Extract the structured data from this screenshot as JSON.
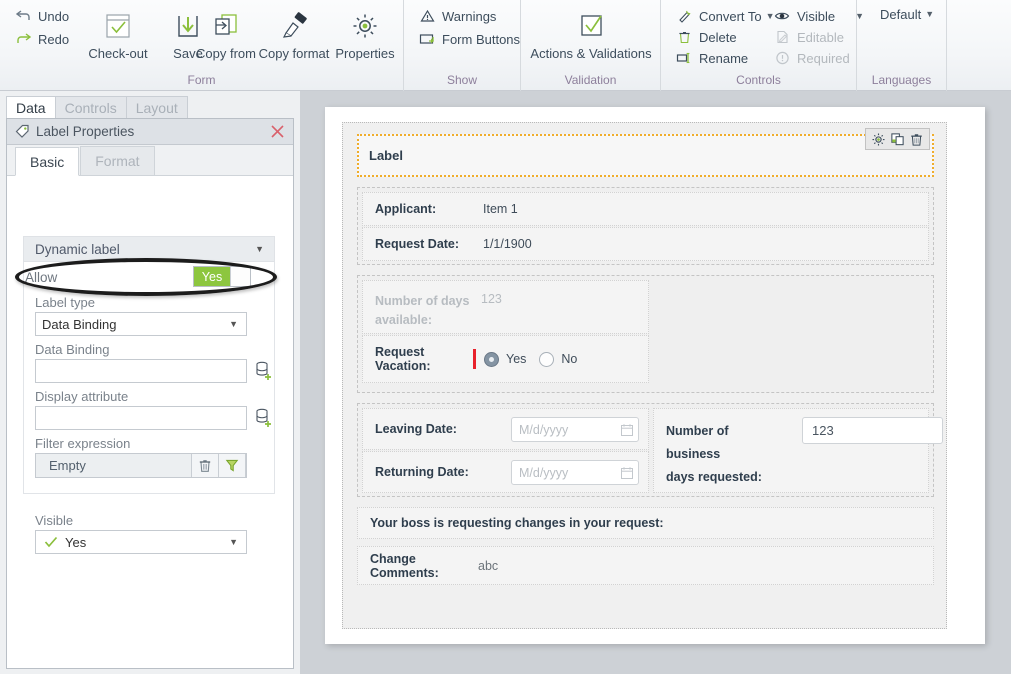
{
  "ribbon": {
    "groups": [
      {
        "name": "Form",
        "label": "Form",
        "small_commands": [
          {
            "label": "Undo",
            "icon": "undo-icon",
            "disabled": false
          },
          {
            "label": "Redo",
            "icon": "redo-icon",
            "disabled": false
          }
        ],
        "large_commands": [
          {
            "label": "Check-out",
            "icon": "checkout-icon"
          },
          {
            "label": "Save",
            "icon": "save-icon"
          },
          {
            "label": "Copy from",
            "icon": "copy-from-icon"
          },
          {
            "label": "Copy format",
            "icon": "copy-format-icon"
          },
          {
            "label": "Properties",
            "icon": "properties-gear-icon"
          }
        ]
      },
      {
        "name": "Show",
        "label": "Show",
        "small_commands": [
          {
            "label": "Warnings",
            "icon": "warning-triangle-icon",
            "disabled": false
          },
          {
            "label": "Form Buttons",
            "icon": "form-buttons-icon",
            "disabled": false
          }
        ],
        "large_commands": []
      },
      {
        "name": "Validation",
        "label": "Validation",
        "small_commands": [],
        "large_commands": [
          {
            "label": "Actions & Validations",
            "icon": "checkbox-check-icon"
          }
        ]
      },
      {
        "name": "Controls",
        "label": "Controls",
        "small_commands": [
          {
            "label": "Convert To",
            "icon": "convert-to-icon",
            "disabled": false,
            "caret": true
          },
          {
            "label": "Delete",
            "icon": "trash-icon",
            "disabled": false
          },
          {
            "label": "Rename",
            "icon": "rename-icon",
            "disabled": false
          },
          {
            "label": "Visible",
            "icon": "eye-icon",
            "disabled": false,
            "caret": true
          },
          {
            "label": "Editable",
            "icon": "editable-icon",
            "disabled": true
          },
          {
            "label": "Required",
            "icon": "required-icon",
            "disabled": true
          }
        ],
        "large_commands": []
      },
      {
        "name": "Languages",
        "label": "Languages",
        "small_commands": [
          {
            "label": "Default",
            "icon": "none",
            "disabled": false,
            "caret": true
          }
        ],
        "large_commands": []
      }
    ]
  },
  "left_panel": {
    "tabs": [
      {
        "label": "Data",
        "active": true
      },
      {
        "label": "Controls",
        "active": false
      },
      {
        "label": "Layout",
        "active": false
      }
    ],
    "properties_panel": {
      "title": "Label Properties",
      "title_icon": "tag-icon",
      "close_icon": "close-icon",
      "sub_tabs": [
        {
          "label": "Basic",
          "active": true
        },
        {
          "label": "Format",
          "active": false
        }
      ],
      "group": {
        "header": "Dynamic label",
        "allow": {
          "label": "Allow",
          "value": "Yes",
          "highlighted": true
        },
        "label_type": {
          "label": "Label type",
          "value": "Data Binding"
        },
        "data_binding": {
          "label": "Data Binding",
          "value": "",
          "button_icon": "database-add-icon"
        },
        "display_attribute": {
          "label": "Display attribute",
          "value": "",
          "button_icon": "database-add-icon"
        },
        "filter_expression": {
          "label": "Filter expression",
          "value": "Empty",
          "delete_icon": "trash-icon",
          "filter_icon": "funnel-icon"
        }
      },
      "visible": {
        "label": "Visible",
        "value": "Yes",
        "icon": "check-icon"
      }
    }
  },
  "form_canvas": {
    "selected_control": {
      "text": "Label",
      "tools": [
        {
          "icon": "gear-icon",
          "name": "settings"
        },
        {
          "icon": "duplicate-icon",
          "name": "duplicate"
        },
        {
          "icon": "trash-icon",
          "name": "delete"
        }
      ]
    },
    "sections": [
      {
        "name": "applicant-section",
        "rows": [
          {
            "label": "Applicant:",
            "value": "Item 1",
            "muted": false
          },
          {
            "label": "Request Date:",
            "value": "1/1/1900",
            "muted": false
          }
        ]
      }
    ],
    "days_available": {
      "label": "Number of days available:",
      "label_line1": "Number of days",
      "label_line2": "available:",
      "value": "123",
      "muted": true
    },
    "request_vacation": {
      "label": "Request Vacation:",
      "required": true,
      "options": [
        {
          "label": "Yes",
          "selected": true
        },
        {
          "label": "No",
          "selected": false
        }
      ]
    },
    "leaving_date": {
      "label": "Leaving Date:",
      "placeholder": "M/d/yyyy",
      "value": "",
      "icon": "calendar-icon"
    },
    "returning_date": {
      "label": "Returning Date:",
      "placeholder": "M/d/yyyy",
      "value": "",
      "icon": "calendar-icon"
    },
    "business_days": {
      "label_line1": "Number of business",
      "label_line2": "days requested:",
      "value": "123"
    },
    "boss_message": "Your boss is requesting changes in your request:",
    "change_comments": {
      "label": "Change Comments:",
      "value": "abc"
    }
  },
  "colors": {
    "accent_green": "#8dc63f",
    "selection_orange": "#f0ad2b",
    "required_red": "#e8212b",
    "ribbon_group_label": "#8d7f9b",
    "text_primary": "#3d4d5c"
  }
}
